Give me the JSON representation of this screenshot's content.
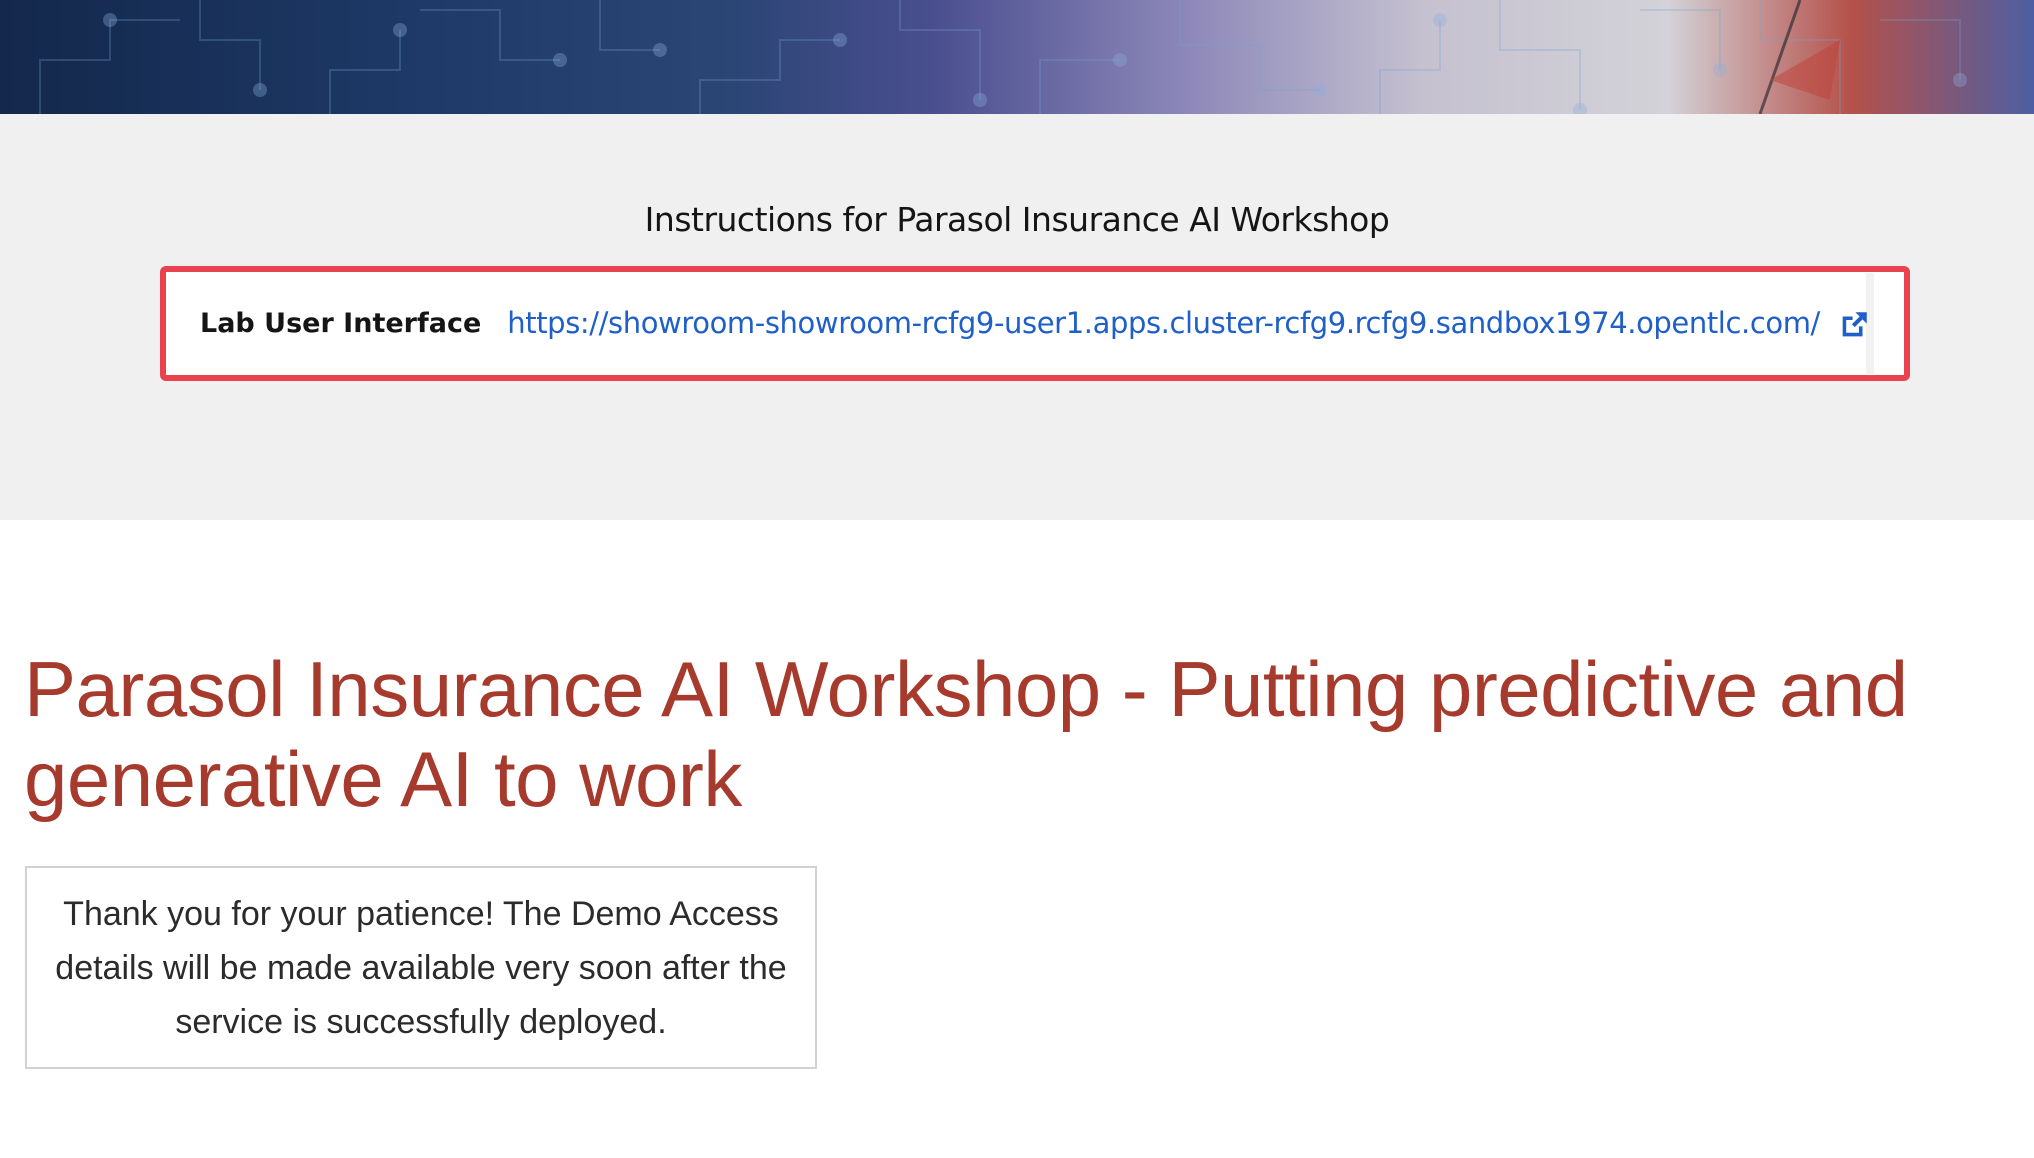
{
  "header": {
    "title": "Instructions for Parasol Insurance AI Workshop"
  },
  "lab_interface": {
    "label": "Lab User Interface",
    "url": "https://showroom-showroom-rcfg9-user1.apps.cluster-rcfg9.rcfg9.sandbox1974.opentlc.com/",
    "icon": "external-link-icon",
    "highlight_color": "#e8434f",
    "link_color": "#1f5fc8"
  },
  "main": {
    "heading": "Parasol Insurance AI Workshop - Putting predictive and generative AI to work",
    "heading_color": "#a63a2c",
    "notice": "Thank you for your patience! The Demo Access details will be made available very soon after the service is successfully deployed."
  }
}
